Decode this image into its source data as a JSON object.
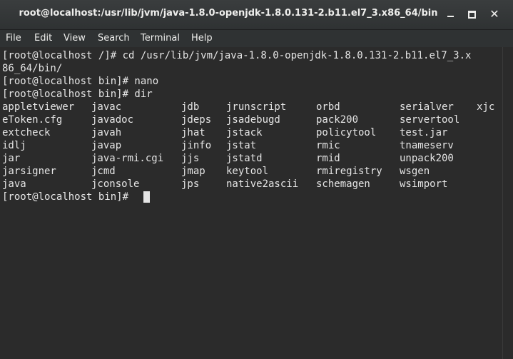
{
  "window": {
    "title": "root@localhost:/usr/lib/jvm/java-1.8.0-openjdk-1.8.0.131-2.b11.el7_3.x86_64/bin",
    "minimize_label": "minimize",
    "maximize_label": "maximize",
    "close_label": "close"
  },
  "menu": {
    "file": "File",
    "edit": "Edit",
    "view": "View",
    "search": "Search",
    "terminal": "Terminal",
    "help": "Help"
  },
  "terminal": {
    "lines": [
      "[root@localhost /]# cd /usr/lib/jvm/java-1.8.0-openjdk-1.8.0.131-2.b11.el7_3.x",
      "86_64/bin/",
      "[root@localhost bin]# nano",
      "[root@localhost bin]# dir"
    ],
    "listing": [
      [
        "appletviewer",
        "javac",
        "jdb",
        "jrunscript",
        "orbd",
        "serialver",
        "xjc"
      ],
      [
        "eToken.cfg",
        "javadoc",
        "jdeps",
        "jsadebugd",
        "pack200",
        "servertool",
        ""
      ],
      [
        "extcheck",
        "javah",
        "jhat",
        "jstack",
        "policytool",
        "test.jar",
        ""
      ],
      [
        "idlj",
        "javap",
        "jinfo",
        "jstat",
        "rmic",
        "tnameserv",
        ""
      ],
      [
        "jar",
        "java-rmi.cgi",
        "jjs",
        "jstatd",
        "rmid",
        "unpack200",
        ""
      ],
      [
        "jarsigner",
        "jcmd",
        "jmap",
        "keytool",
        "rmiregistry",
        "wsgen",
        ""
      ],
      [
        "java",
        "jconsole",
        "jps",
        "native2ascii",
        "schemagen",
        "wsimport",
        ""
      ]
    ],
    "prompt": "[root@localhost bin]# "
  },
  "colors": {
    "background": "#2b2b2b",
    "foreground": "#e5e5e5",
    "titlebar": "#2f3233"
  }
}
